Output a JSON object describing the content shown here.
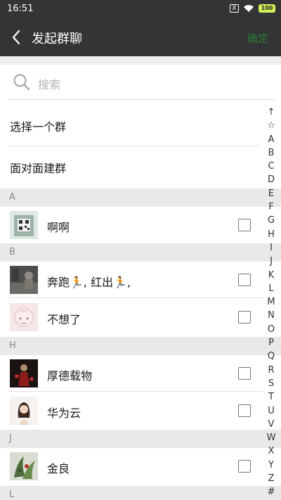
{
  "status_bar": {
    "time": "16:51",
    "sim_label": "X",
    "battery": "100"
  },
  "header": {
    "title": "发起群聊",
    "confirm_label": "确定"
  },
  "search": {
    "placeholder": "搜索"
  },
  "options": [
    "选择一个群",
    "面对面建群"
  ],
  "sections": [
    {
      "letter": "A",
      "contacts": [
        {
          "name": "啊啊"
        }
      ]
    },
    {
      "letter": "B",
      "contacts": [
        {
          "name": "奔跑🏃, 红出🏃,"
        },
        {
          "name": "不想了"
        }
      ]
    },
    {
      "letter": "H",
      "contacts": [
        {
          "name": "厚德载物"
        },
        {
          "name": "华为云"
        }
      ]
    },
    {
      "letter": "J",
      "contacts": [
        {
          "name": "金良"
        }
      ]
    },
    {
      "letter": "L",
      "contacts": []
    }
  ],
  "index_letters": [
    "↑",
    "☆",
    "A",
    "B",
    "C",
    "D",
    "E",
    "F",
    "G",
    "H",
    "I",
    "J",
    "K",
    "L",
    "M",
    "N",
    "O",
    "P",
    "Q",
    "R",
    "S",
    "T",
    "U",
    "V",
    "W",
    "X",
    "Y",
    "Z",
    "#"
  ],
  "colors": {
    "header_bg": "#333435",
    "confirm_text": "#2b7a34",
    "section_bg": "#e9e9e9",
    "battery": "#d2ef57"
  }
}
